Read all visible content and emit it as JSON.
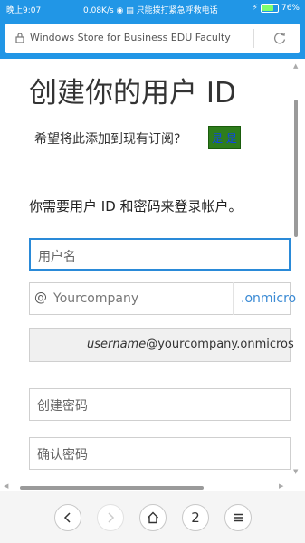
{
  "status": {
    "time": "晚上9:07",
    "speed": "0.08K/s",
    "network": "只能拨打紧急呼救电话",
    "battery": "76%",
    "battery_level": 0.76
  },
  "browser": {
    "url": "Windows Store for Business EDU Faculty",
    "tab_count": "2"
  },
  "page": {
    "title": "创建你的用户 ID",
    "subtitle": "希望将此添加到现有订阅?",
    "yes_button": "是 是",
    "prompt": "你需要用户 ID 和密码来登录帐户。",
    "username_placeholder": "用户名",
    "at_sign": "@",
    "company_placeholder": "Yourcompany",
    "domain_suffix": ".onmicro",
    "example_user": "username",
    "example_domain": "@yourcompany.onmicros",
    "password_placeholder": "创建密码",
    "confirm_password_placeholder": "确认密码"
  },
  "colors": {
    "accent": "#2196e6",
    "link": "#3a8ad4",
    "yes_bg": "#2e7d1c"
  }
}
